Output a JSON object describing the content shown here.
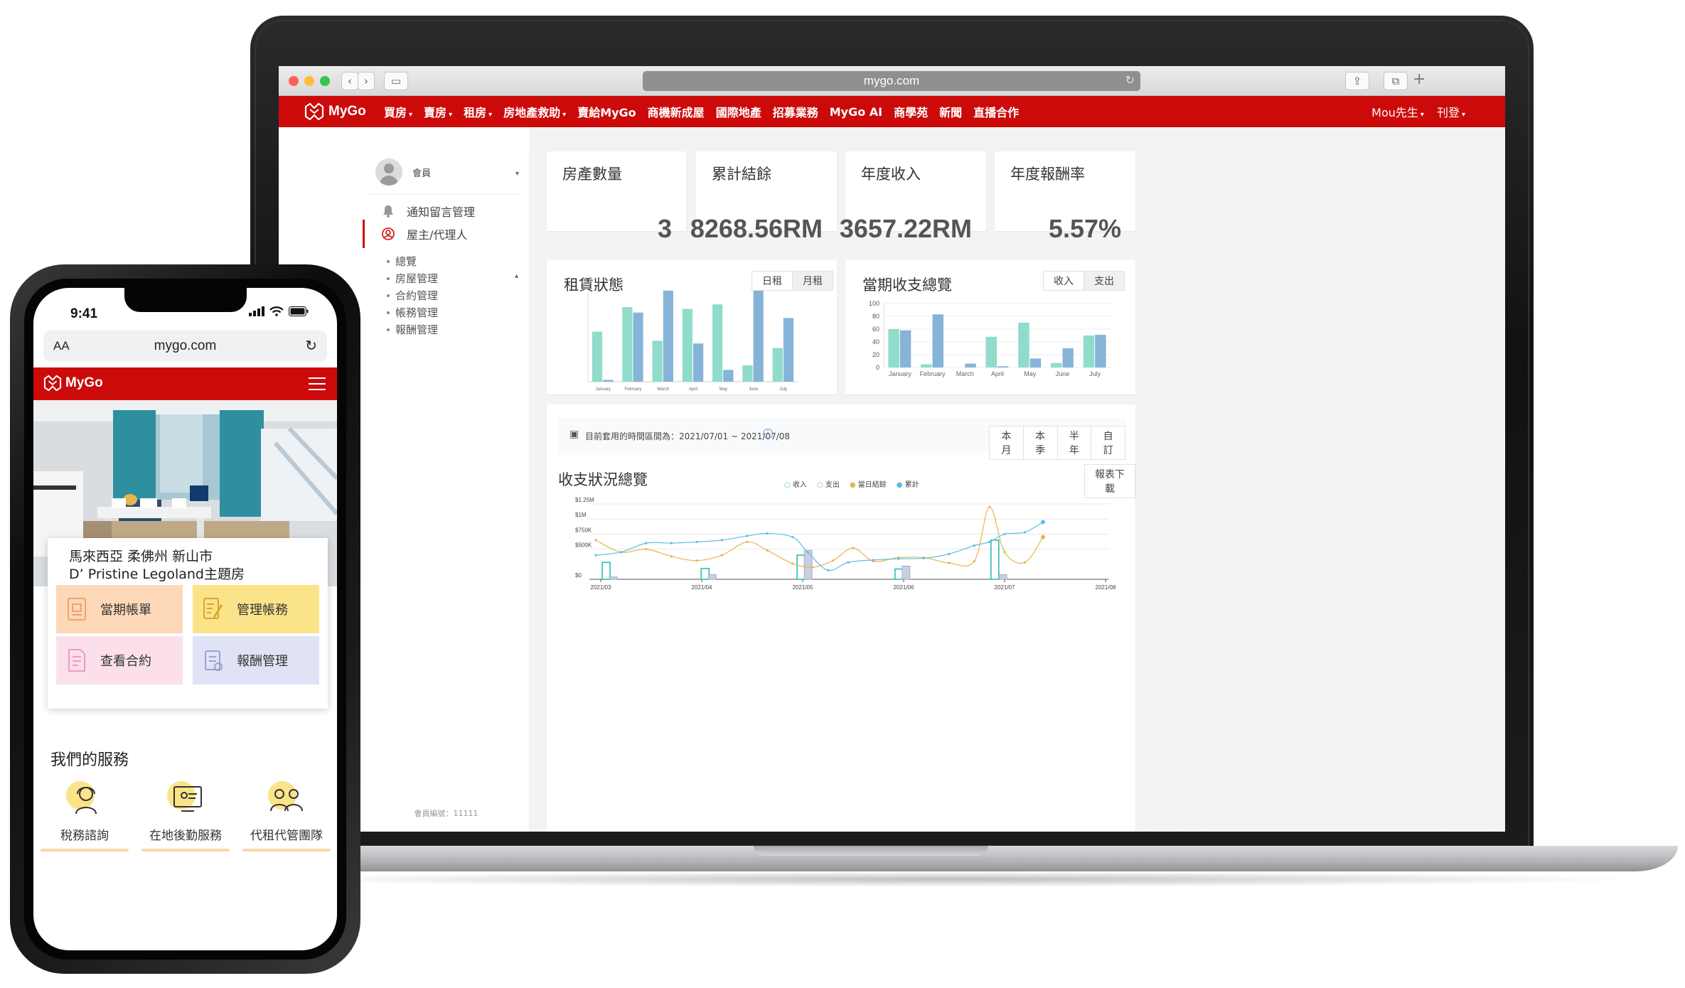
{
  "desktop": {
    "browser": {
      "url": "mygo.com"
    },
    "brand": "MyGo",
    "nav": {
      "items": [
        {
          "label": "買房",
          "dropdown": true
        },
        {
          "label": "賣房",
          "dropdown": true
        },
        {
          "label": "租房",
          "dropdown": true
        },
        {
          "label": "房地產救助",
          "dropdown": true
        },
        {
          "label": "賣給MyGo",
          "dropdown": false
        },
        {
          "label": "商機新成屋",
          "dropdown": false
        },
        {
          "label": "國際地產",
          "dropdown": false
        },
        {
          "label": "招募業務",
          "dropdown": false
        },
        {
          "label": "MyGo AI",
          "dropdown": false
        },
        {
          "label": "商學苑",
          "dropdown": false
        },
        {
          "label": "新聞",
          "dropdown": false
        },
        {
          "label": "直播合作",
          "dropdown": false
        }
      ],
      "user": "Mou先生",
      "publish": "刊登"
    },
    "sidebar": {
      "member_label": "會員",
      "items": [
        {
          "label": "通知留言管理",
          "icon": "bell-icon"
        },
        {
          "label": "屋主/代理人",
          "icon": "user-circle-icon"
        }
      ],
      "sub_items": [
        "總覽",
        "房屋管理",
        "合約管理",
        "帳務管理",
        "報酬管理"
      ],
      "member_id": "會員編號：11111"
    },
    "stats": [
      {
        "title": "房產數量",
        "value": "3"
      },
      {
        "title": "累計結餘",
        "value": "8268.56RM"
      },
      {
        "title": "年度收入",
        "value": "3657.22RM"
      },
      {
        "title": "年度報酬率",
        "value": "5.57%"
      }
    ],
    "rental_panel": {
      "title": "租賃狀態",
      "toggle": [
        "日租",
        "月租"
      ]
    },
    "income_panel": {
      "title": "當期收支總覽",
      "toggle": [
        "收入",
        "支出"
      ]
    },
    "overview": {
      "period_text": "目前套用的時間區間為：2021/07/01 ~ 2021/07/08",
      "ranges": [
        "本月",
        "本季",
        "半年",
        "自訂"
      ],
      "title": "收支狀況總覽",
      "download": "報表下載",
      "legend": [
        "收入",
        "支出",
        "當日結餘",
        "累計"
      ]
    },
    "colors": {
      "brand_red": "#cc0a0a",
      "teal": "#8fdcca",
      "blue": "#86b4d8",
      "line_blue": "#5fbde6",
      "line_gold": "#e7b54e",
      "bar_gray": "#c8cfe0"
    }
  },
  "chart_data": [
    {
      "type": "bar",
      "title": "租賃狀態",
      "categories": [
        "January",
        "February",
        "March",
        "April",
        "May",
        "June",
        "July"
      ],
      "series": [
        {
          "values": [
            55,
            82,
            45,
            80,
            85,
            18,
            37
          ]
        },
        {
          "values": [
            2,
            76,
            100,
            42,
            13,
            100,
            70
          ]
        }
      ],
      "ylim": [
        0,
        100
      ]
    },
    {
      "type": "bar",
      "title": "當期收支總覽",
      "categories": [
        "January",
        "February",
        "March",
        "April",
        "May",
        "June",
        "July"
      ],
      "series": [
        {
          "values": [
            60,
            5,
            0,
            48,
            70,
            7,
            50
          ]
        },
        {
          "values": [
            58,
            83,
            6,
            2,
            14,
            30,
            51
          ]
        }
      ],
      "yticks": [
        0,
        20,
        40,
        60,
        80,
        100
      ],
      "ylim": [
        0,
        100
      ]
    },
    {
      "type": "line",
      "title": "收支狀況總覽",
      "x_ticks": [
        "2021/03",
        "2021/04",
        "2021/05",
        "2021/06",
        "2021/07",
        "2021/08"
      ],
      "y_ticks": [
        "$0",
        "$500K",
        "$750K",
        "$1M",
        "$1.25M"
      ],
      "ylim": [
        0,
        1250000
      ],
      "series": [
        {
          "name": "收入",
          "type": "bar",
          "points": [
            [
              0.05,
              280000
            ],
            [
              1.03,
              180000
            ],
            [
              1.98,
              400000
            ],
            [
              2.95,
              170000
            ],
            [
              3.9,
              650000
            ]
          ]
        },
        {
          "name": "支出",
          "type": "bar",
          "points": [
            [
              0.12,
              40000
            ],
            [
              1.1,
              80000
            ],
            [
              2.05,
              480000
            ],
            [
              3.02,
              220000
            ],
            [
              3.98,
              80000
            ]
          ]
        },
        {
          "name": "當日結餘",
          "type": "line",
          "points": [
            [
              -0.05,
              650000
            ],
            [
              0.2,
              450000
            ],
            [
              0.45,
              500000
            ],
            [
              0.7,
              380000
            ],
            [
              0.95,
              310000
            ],
            [
              1.2,
              400000
            ],
            [
              1.45,
              620000
            ],
            [
              1.65,
              480000
            ],
            [
              1.9,
              260000
            ],
            [
              2.1,
              200000
            ],
            [
              2.3,
              310000
            ],
            [
              2.5,
              520000
            ],
            [
              2.7,
              300000
            ],
            [
              2.95,
              360000
            ],
            [
              3.2,
              360000
            ],
            [
              3.45,
              270000
            ],
            [
              3.7,
              300000
            ],
            [
              3.85,
              1200000
            ],
            [
              4.0,
              450000
            ],
            [
              4.2,
              280000
            ],
            [
              4.38,
              700000
            ]
          ]
        },
        {
          "name": "累計",
          "type": "line",
          "points": [
            [
              -0.05,
              400000
            ],
            [
              0.2,
              450000
            ],
            [
              0.45,
              600000
            ],
            [
              0.7,
              600000
            ],
            [
              0.95,
              620000
            ],
            [
              1.2,
              650000
            ],
            [
              1.45,
              720000
            ],
            [
              1.65,
              760000
            ],
            [
              1.9,
              700000
            ],
            [
              2.05,
              450000
            ],
            [
              2.25,
              150000
            ],
            [
              2.45,
              280000
            ],
            [
              2.7,
              320000
            ],
            [
              2.95,
              340000
            ],
            [
              3.2,
              350000
            ],
            [
              3.45,
              420000
            ],
            [
              3.7,
              560000
            ],
            [
              3.85,
              620000
            ],
            [
              4.0,
              750000
            ],
            [
              4.2,
              780000
            ],
            [
              4.38,
              950000
            ]
          ]
        }
      ]
    }
  ],
  "mobile": {
    "time": "9:41",
    "aa": "AA",
    "url": "mygo.com",
    "brand": "MyGo",
    "location_line1": "馬來西亞 柔佛州 新山市",
    "location_line2": "D’ Pristine Legoland主題房",
    "tiles": [
      {
        "label": "當期帳單",
        "bg": "#fcd8b8"
      },
      {
        "label": "管理帳務",
        "bg": "#fbe38a"
      },
      {
        "label": "查看合約",
        "bg": "#fbe0ec"
      },
      {
        "label": "報酬管理",
        "bg": "#e0e3f6"
      }
    ],
    "services_title": "我們的服務",
    "services": [
      "稅務諮詢",
      "在地後勤服務",
      "代租代管團隊"
    ]
  }
}
